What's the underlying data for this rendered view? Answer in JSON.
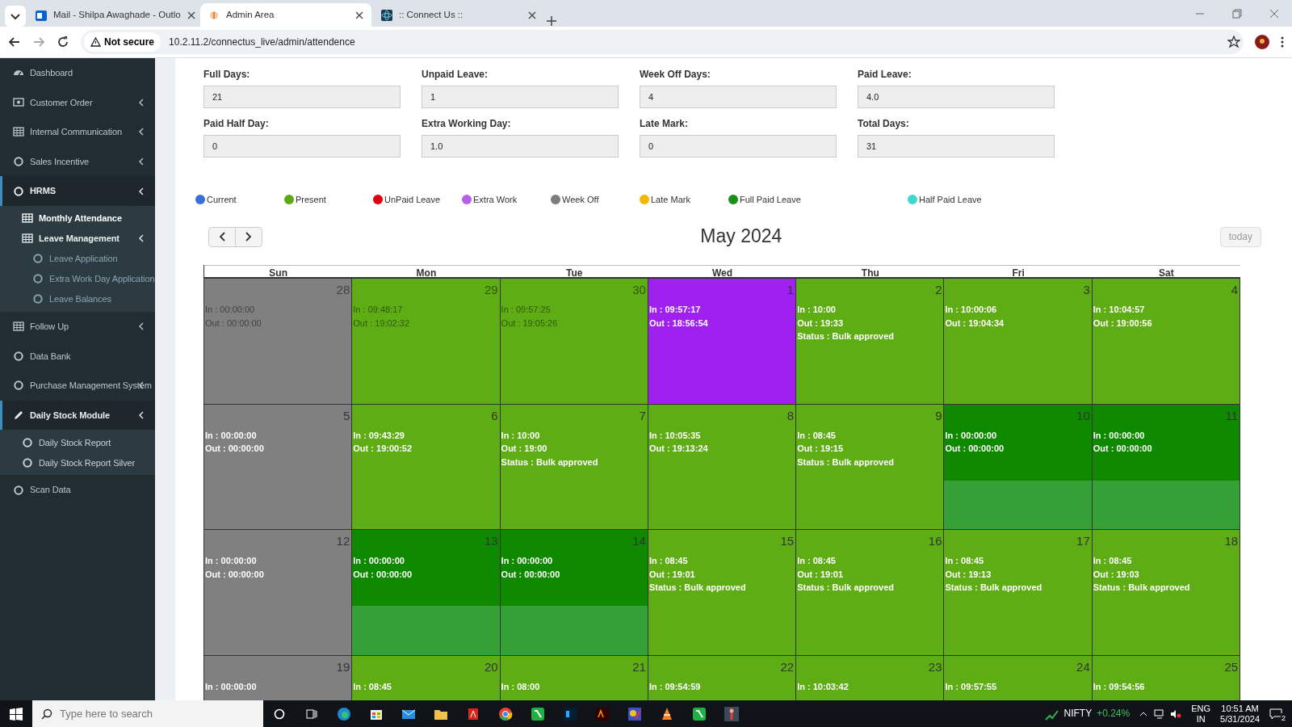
{
  "browser": {
    "tabs": [
      {
        "title": "Mail - Shilpa Awaghade - Outlo",
        "selected": false
      },
      {
        "title": "Admin Area",
        "selected": true
      },
      {
        "title": ":: Connect Us ::",
        "selected": false
      }
    ],
    "security": "Not secure",
    "url": "10.2.11.2/connectus_live/admin/attendence"
  },
  "sidebar": {
    "items": [
      {
        "label": "Dashboard",
        "expandable": false,
        "expanded": false,
        "selected": false
      },
      {
        "label": "Customer Order",
        "expandable": true,
        "expanded": false,
        "selected": false
      },
      {
        "label": "Internal Communication",
        "expandable": true,
        "expanded": false,
        "selected": false
      },
      {
        "label": "Sales Incentive",
        "expandable": true,
        "expanded": false,
        "selected": false
      },
      {
        "label": "HRMS",
        "expandable": true,
        "expanded": true,
        "selected": false,
        "children": [
          {
            "label": "Monthly Attendance",
            "expandable": false,
            "expanded": false,
            "selected": true
          },
          {
            "label": "Leave Management",
            "expandable": true,
            "expanded": true,
            "selected": false,
            "children": [
              {
                "label": "Leave Application",
                "expandable": false,
                "expanded": false,
                "selected": false
              },
              {
                "label": "Extra Work Day Application",
                "expandable": false,
                "expanded": false,
                "selected": false
              },
              {
                "label": "Leave Balances",
                "expandable": false,
                "expanded": false,
                "selected": false
              }
            ]
          }
        ]
      },
      {
        "label": "Follow Up",
        "expandable": true,
        "expanded": false,
        "selected": false
      },
      {
        "label": "Data Bank",
        "expandable": false,
        "expanded": false,
        "selected": false
      },
      {
        "label": "Purchase Management System",
        "expandable": true,
        "expanded": false,
        "selected": false
      },
      {
        "label": "Daily Stock Module",
        "expandable": true,
        "expanded": true,
        "selected": false,
        "children": [
          {
            "label": "Daily Stock Report",
            "expandable": false,
            "expanded": false,
            "selected": false
          },
          {
            "label": "Daily Stock Report Silver",
            "expandable": false,
            "expanded": false,
            "selected": false
          }
        ]
      },
      {
        "label": "Scan Data",
        "expandable": false,
        "expanded": false,
        "selected": false
      }
    ]
  },
  "summary": [
    {
      "label": "Full Days:",
      "value": "21"
    },
    {
      "label": "Unpaid Leave:",
      "value": "1"
    },
    {
      "label": "Week Off Days:",
      "value": "4"
    },
    {
      "label": "Paid Leave:",
      "value": "4.0"
    },
    {
      "label": "Paid Half Day:",
      "value": "0"
    },
    {
      "label": "Extra Working Day:",
      "value": "1.0"
    },
    {
      "label": "Late Mark:",
      "value": "0"
    },
    {
      "label": "Total Days:",
      "value": "31"
    }
  ],
  "legend": [
    {
      "label": "Current",
      "color": "#3b6fd6"
    },
    {
      "label": "Present",
      "color": "#5cab16"
    },
    {
      "label": "UnPaid Leave",
      "color": "#e00010"
    },
    {
      "label": "Extra Work",
      "color": "#b560e6"
    },
    {
      "label": "Week Off",
      "color": "#7d7d7d"
    },
    {
      "label": "Late Mark",
      "color": "#f4b800"
    },
    {
      "label": "Full Paid Leave",
      "color": "#18901a"
    },
    {
      "label": "Half Paid Leave",
      "color": "#3fd8cc"
    }
  ],
  "calendar": {
    "title": "May 2024",
    "today_button": "today",
    "today_disabled": true,
    "weekdays": [
      "Sun",
      "Mon",
      "Tue",
      "Wed",
      "Thu",
      "Fri",
      "Sat"
    ],
    "weeks": [
      [
        {
          "date": "28",
          "kind": "week_off",
          "other_month": true,
          "in": "In : 00:00:00",
          "out": "Out : 00:00:00"
        },
        {
          "date": "29",
          "kind": "present",
          "other_month": true,
          "in": "In : 09:48:17",
          "out": "Out : 19:02:32"
        },
        {
          "date": "30",
          "kind": "present",
          "other_month": true,
          "in": "In : 09:57:25",
          "out": "Out : 19:05:26"
        },
        {
          "date": "1",
          "kind": "extra_work",
          "other_month": false,
          "in": "In : 09:57:17",
          "out": "Out : 18:56:54"
        },
        {
          "date": "2",
          "kind": "present",
          "other_month": false,
          "in": "In : 10:00",
          "out": "Out : 19:33",
          "status": "Status : Bulk approved"
        },
        {
          "date": "3",
          "kind": "present",
          "other_month": false,
          "in": "In : 10:00:06",
          "out": "Out : 19:04:34"
        },
        {
          "date": "4",
          "kind": "present",
          "other_month": false,
          "in": "In : 10:04:57",
          "out": "Out : 19:00:56"
        }
      ],
      [
        {
          "date": "5",
          "kind": "week_off",
          "other_month": false,
          "in": "In : 00:00:00",
          "out": "Out : 00:00:00"
        },
        {
          "date": "6",
          "kind": "present",
          "other_month": false,
          "in": "In : 09:43:29",
          "out": "Out : 19:00:52"
        },
        {
          "date": "7",
          "kind": "present",
          "other_month": false,
          "in": "In : 10:00",
          "out": "Out : 19:00",
          "status": "Status : Bulk approved"
        },
        {
          "date": "8",
          "kind": "present",
          "other_month": false,
          "in": "In : 10:05:35",
          "out": "Out : 19:13:24"
        },
        {
          "date": "9",
          "kind": "present",
          "other_month": false,
          "in": "In : 08:45",
          "out": "Out : 19:15",
          "status": "Status : Bulk approved"
        },
        {
          "date": "10",
          "kind": "full_paid_leave",
          "other_month": false,
          "in": "In : 00:00:00",
          "out": "Out : 00:00:00"
        },
        {
          "date": "11",
          "kind": "full_paid_leave",
          "other_month": false,
          "in": "In : 00:00:00",
          "out": "Out : 00:00:00"
        }
      ],
      [
        {
          "date": "12",
          "kind": "week_off",
          "other_month": false,
          "in": "In : 00:00:00",
          "out": "Out : 00:00:00"
        },
        {
          "date": "13",
          "kind": "full_paid_leave",
          "other_month": false,
          "in": "In : 00:00:00",
          "out": "Out : 00:00:00"
        },
        {
          "date": "14",
          "kind": "full_paid_leave",
          "other_month": false,
          "in": "In : 00:00:00",
          "out": "Out : 00:00:00"
        },
        {
          "date": "15",
          "kind": "present",
          "other_month": false,
          "in": "In : 08:45",
          "out": "Out : 19:01",
          "status": "Status : Bulk approved"
        },
        {
          "date": "16",
          "kind": "present",
          "other_month": false,
          "in": "In : 08:45",
          "out": "Out : 19:01",
          "status": "Status : Bulk approved"
        },
        {
          "date": "17",
          "kind": "present",
          "other_month": false,
          "in": "In : 08:45",
          "out": "Out : 19:13",
          "status": "Status : Bulk approved"
        },
        {
          "date": "18",
          "kind": "present",
          "other_month": false,
          "in": "In : 08:45",
          "out": "Out : 19:03",
          "status": "Status : Bulk approved"
        }
      ],
      [
        {
          "date": "19",
          "kind": "week_off",
          "other_month": false,
          "in": "In : 00:00:00"
        },
        {
          "date": "20",
          "kind": "present",
          "other_month": false,
          "in": "In : 08:45"
        },
        {
          "date": "21",
          "kind": "present",
          "other_month": false,
          "in": "In : 08:00"
        },
        {
          "date": "22",
          "kind": "present",
          "other_month": false,
          "in": "In : 09:54:59"
        },
        {
          "date": "23",
          "kind": "present",
          "other_month": false,
          "in": "In : 10:03:42"
        },
        {
          "date": "24",
          "kind": "present",
          "other_month": false,
          "in": "In : 09:57:55"
        },
        {
          "date": "25",
          "kind": "present",
          "other_month": false,
          "in": "In : 09:54:56"
        }
      ]
    ]
  },
  "taskbar": {
    "search": {
      "placeholder": "Type here to search"
    },
    "ticker": "NIFTY",
    "change": "+0.24%",
    "lang": "ENG",
    "region": "IN",
    "time": "10:51 AM",
    "date": "5/31/2024",
    "notifications": "2"
  }
}
